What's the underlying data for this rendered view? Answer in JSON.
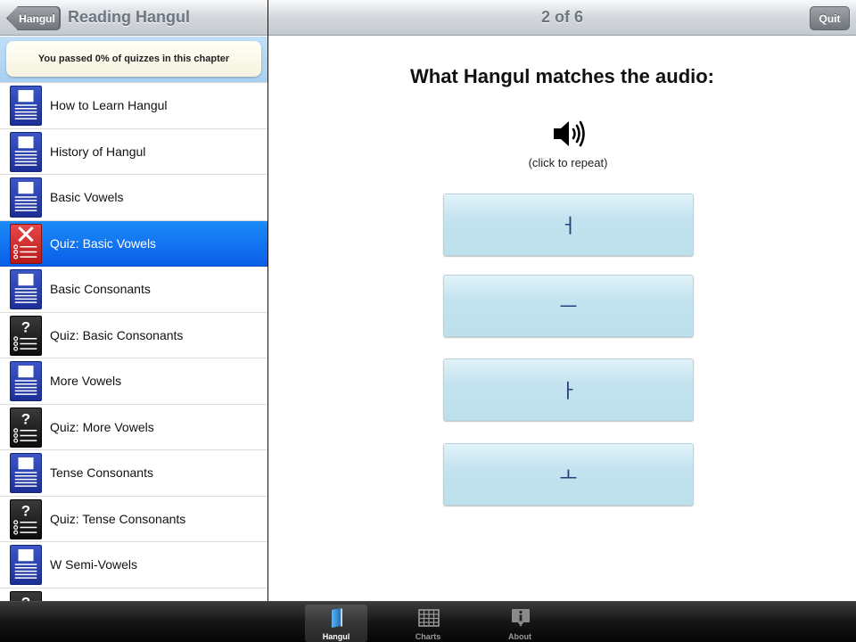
{
  "left": {
    "back_label": "Hangul",
    "title": "Reading Hangul",
    "progress_text": "You passed 0% of quizzes in this chapter",
    "items": [
      {
        "label": "How to Learn Hangul",
        "icon": "lesson-icon"
      },
      {
        "label": "History of Hangul",
        "icon": "lesson-icon"
      },
      {
        "label": "Basic Vowels",
        "icon": "lesson-icon"
      },
      {
        "label": "Quiz: Basic Vowels",
        "icon": "quiz-failed-icon"
      },
      {
        "label": "Basic Consonants",
        "icon": "lesson-icon"
      },
      {
        "label": "Quiz: Basic Consonants",
        "icon": "quiz-icon"
      },
      {
        "label": "More Vowels",
        "icon": "lesson-icon"
      },
      {
        "label": "Quiz: More Vowels",
        "icon": "quiz-icon"
      },
      {
        "label": "Tense Consonants",
        "icon": "lesson-icon"
      },
      {
        "label": "Quiz: Tense Consonants",
        "icon": "quiz-icon"
      },
      {
        "label": "W Semi-Vowels",
        "icon": "lesson-icon"
      }
    ]
  },
  "right": {
    "counter": "2 of 6",
    "quit_label": "Quit",
    "question": "What Hangul matches the audio:",
    "repeat_hint": "(click to repeat)",
    "answers": [
      "ㅓ",
      "ㅡ",
      "ㅏ",
      "ㅗ"
    ]
  },
  "tabs": [
    {
      "label": "Hangul",
      "icon": "book-icon"
    },
    {
      "label": "Charts",
      "icon": "grid-icon"
    },
    {
      "label": "About",
      "icon": "info-bubble-icon"
    }
  ],
  "colors": {
    "selection": "#0a5ee8",
    "answer_button": "#c2e3ef",
    "lesson_icon": "#2a3fae",
    "failed_icon": "#d32f2f"
  }
}
